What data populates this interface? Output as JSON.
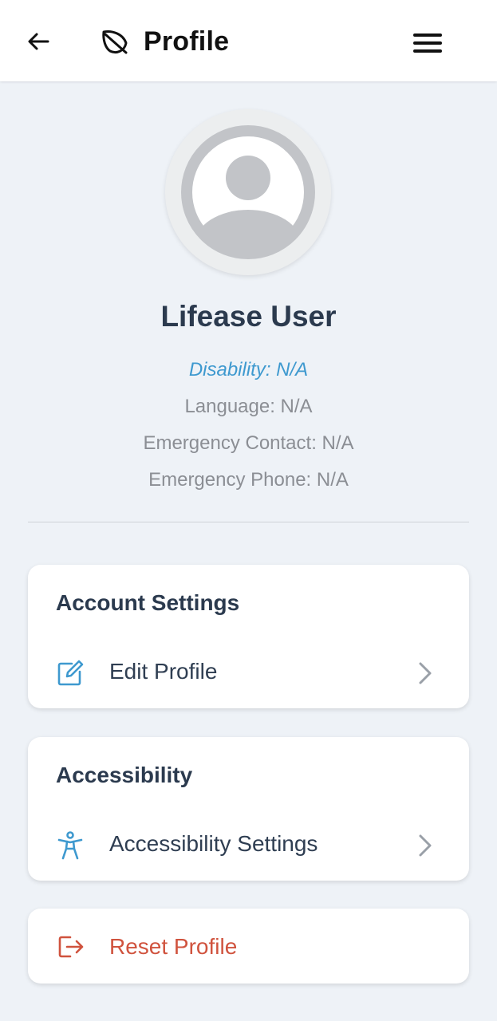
{
  "header": {
    "title": "Profile",
    "back_icon": "arrow-left-icon",
    "logo_icon": "leaf-icon",
    "menu_icon": "hamburger-menu-icon"
  },
  "profile": {
    "name": "Lifease User",
    "disability": "Disability: N/A",
    "language": "Language: N/A",
    "emergency_contact": "Emergency Contact: N/A",
    "emergency_phone": "Emergency Phone: N/A",
    "avatar_icon": "user-avatar-icon"
  },
  "account_settings": {
    "title": "Account Settings",
    "items": [
      {
        "label": "Edit Profile",
        "icon": "edit-icon"
      }
    ]
  },
  "accessibility": {
    "title": "Accessibility",
    "items": [
      {
        "label": "Accessibility Settings",
        "icon": "accessibility-icon"
      }
    ]
  },
  "reset": {
    "label": "Reset Profile",
    "icon": "logout-icon"
  },
  "colors": {
    "background": "#eef2f7",
    "heading": "#2b3a4e",
    "accent_blue": "#3e99cf",
    "danger": "#d0533e",
    "muted": "#8b8e94"
  }
}
